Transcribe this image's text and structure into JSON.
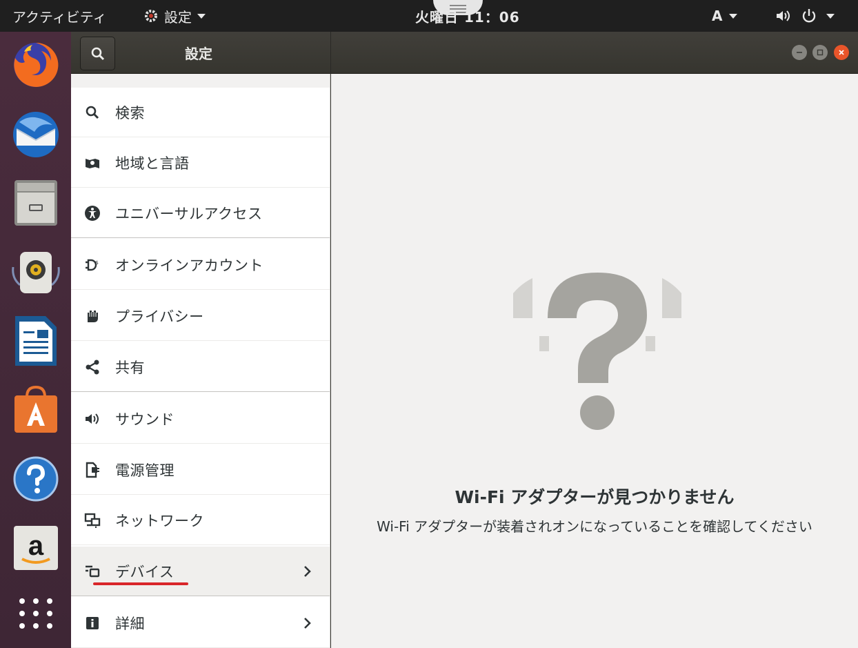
{
  "topbar": {
    "activities": "アクティビティ",
    "app_menu": "設定",
    "clock": "火曜日 11：06",
    "input_method": "A"
  },
  "dock": {
    "items": [
      "firefox-icon",
      "thunderbird-icon",
      "files-icon",
      "rhythmbox-icon",
      "libreoffice-writer-icon",
      "software-center-icon",
      "help-icon",
      "amazon-icon",
      "show-apps-icon"
    ]
  },
  "header": {
    "title": "設定"
  },
  "sidebar": {
    "items": [
      {
        "label": "検索",
        "icon": "search-icon"
      },
      {
        "label": "地域と言語",
        "icon": "region-icon"
      },
      {
        "label": "ユニバーサルアクセス",
        "icon": "universal-access-icon"
      },
      {
        "label": "オンラインアカウント",
        "icon": "online-accounts-icon"
      },
      {
        "label": "プライバシー",
        "icon": "privacy-hand-icon"
      },
      {
        "label": "共有",
        "icon": "share-icon"
      },
      {
        "label": "サウンド",
        "icon": "speaker-icon"
      },
      {
        "label": "電源管理",
        "icon": "power-plug-icon"
      },
      {
        "label": "ネットワーク",
        "icon": "network-icon"
      },
      {
        "label": "デバイス",
        "icon": "devices-icon"
      },
      {
        "label": "詳細",
        "icon": "info-icon"
      }
    ]
  },
  "main": {
    "title": "Wi-Fi アダプターが見つかりません",
    "subtitle": "Wi-Fi アダプターが装着されオンになっていることを確認してください"
  },
  "colors": {
    "accent_underline": "#d9262a",
    "close_button": "#e9552a",
    "dock_background": "#4a2c3d"
  }
}
